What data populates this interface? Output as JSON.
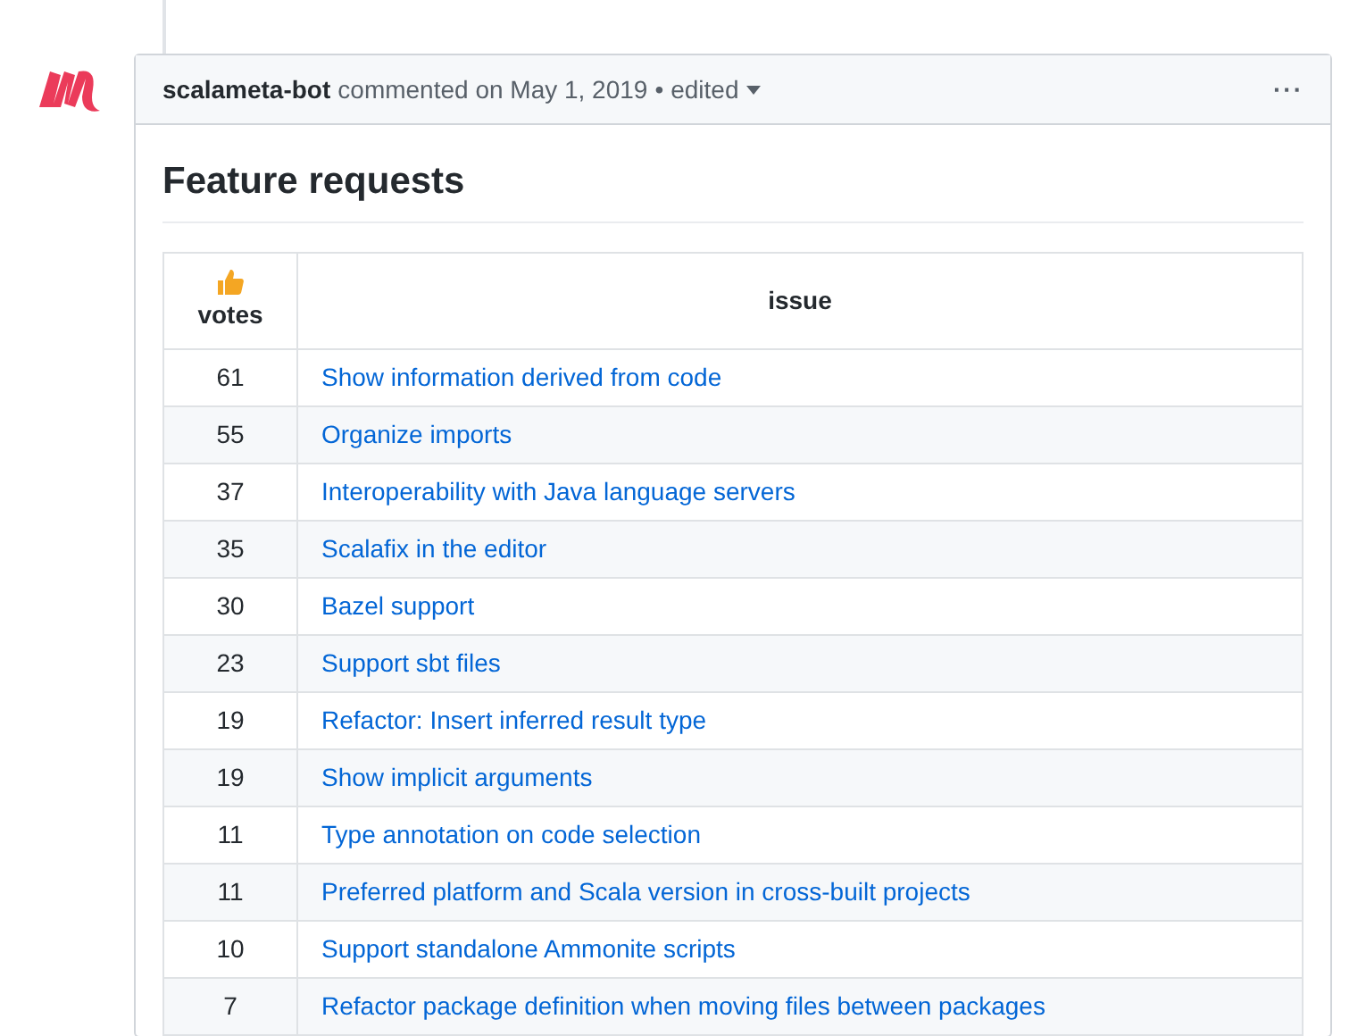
{
  "comment": {
    "author": "scalameta-bot",
    "meta": "commented on May 1, 2019",
    "separator": "•",
    "edited": "edited",
    "more": "···"
  },
  "heading": "Feature requests",
  "table": {
    "columns": [
      "votes",
      "issue"
    ],
    "rows": [
      {
        "votes": "61",
        "issue": "Show information derived from code"
      },
      {
        "votes": "55",
        "issue": "Organize imports"
      },
      {
        "votes": "37",
        "issue": "Interoperability with Java language servers"
      },
      {
        "votes": "35",
        "issue": "Scalafix in the editor"
      },
      {
        "votes": "30",
        "issue": "Bazel support"
      },
      {
        "votes": "23",
        "issue": "Support sbt files"
      },
      {
        "votes": "19",
        "issue": "Refactor: Insert inferred result type"
      },
      {
        "votes": "19",
        "issue": "Show implicit arguments"
      },
      {
        "votes": "11",
        "issue": "Type annotation on code selection"
      },
      {
        "votes": "11",
        "issue": "Preferred platform and Scala version in cross-built projects"
      },
      {
        "votes": "10",
        "issue": "Support standalone Ammonite scripts"
      },
      {
        "votes": "7",
        "issue": "Refactor package definition when moving files between packages"
      }
    ]
  }
}
